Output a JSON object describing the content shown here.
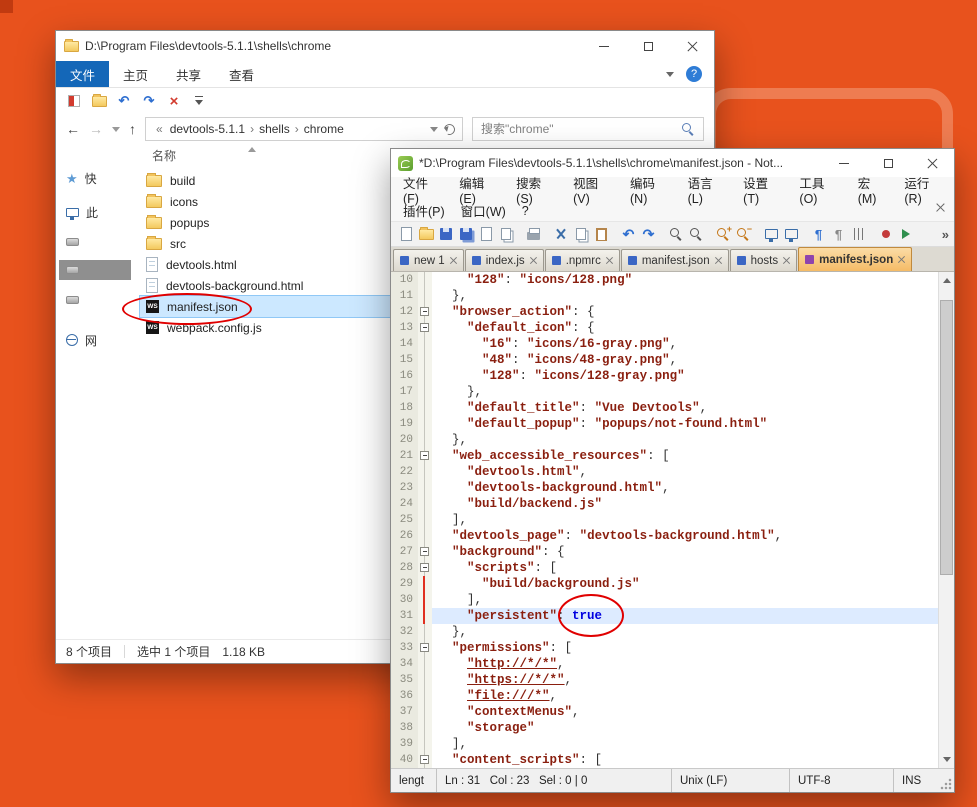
{
  "icons": {
    "ws_badge": "WS",
    "breadcrumb_prefix": "«",
    "breadcrumb_separator": "›",
    "back_arrow": "←",
    "forward_arrow": "→",
    "up_arrow": "↑",
    "undo_glyph": "↶",
    "redo_glyph": "↷",
    "delete_glyph": "×",
    "overflow_glyph": "»",
    "star_glyph": "★",
    "help_glyph": "?",
    "paragraph_glyph": "¶"
  },
  "explorer": {
    "window_title": "D:\\Program Files\\devtools-5.1.1\\shells\\chrome",
    "ribbon_tabs": [
      {
        "label": "文件",
        "active": true
      },
      {
        "label": "主页",
        "active": false
      },
      {
        "label": "共享",
        "active": false
      },
      {
        "label": "查看",
        "active": false
      }
    ],
    "qat_icons": [
      {
        "name": "properties-icon"
      },
      {
        "name": "new-folder-icon"
      },
      {
        "name": "undo-icon"
      },
      {
        "name": "redo-icon"
      },
      {
        "name": "delete-icon"
      },
      {
        "name": "customize-toolbar-icon"
      }
    ],
    "breadcrumb": {
      "prefix": "«",
      "segments": [
        "devtools-5.1.1",
        "shells",
        "chrome"
      ]
    },
    "search": {
      "placeholder": "搜索\"chrome\""
    },
    "columns": {
      "name": "名称"
    },
    "sidebar": [
      {
        "icon": "star-icon",
        "label": "快",
        "selected": false
      },
      {
        "icon": "monitor-icon",
        "label": "此",
        "selected": false
      },
      {
        "icon": "drive-icon",
        "label": "",
        "selected": false
      },
      {
        "icon": "drive-icon",
        "label": "",
        "selected": true
      },
      {
        "icon": "drive-icon",
        "label": "",
        "selected": false
      },
      {
        "icon": "network-icon",
        "label": "网",
        "selected": false
      }
    ],
    "files": [
      {
        "name": "build",
        "type": "folder",
        "selected": false
      },
      {
        "name": "icons",
        "type": "folder",
        "selected": false
      },
      {
        "name": "popups",
        "type": "folder",
        "selected": false
      },
      {
        "name": "src",
        "type": "folder",
        "selected": false
      },
      {
        "name": "devtools.html",
        "type": "html",
        "selected": false
      },
      {
        "name": "devtools-background.html",
        "type": "html",
        "selected": false
      },
      {
        "name": "manifest.json",
        "type": "ws",
        "selected": true
      },
      {
        "name": "webpack.config.js",
        "type": "ws",
        "selected": false
      }
    ],
    "status": {
      "total": "8 个项目",
      "selected": "选中 1 个项目",
      "size": "1.18 KB"
    }
  },
  "notepad": {
    "window_title": "*D:\\Program Files\\devtools-5.1.1\\shells\\chrome\\manifest.json - Not...",
    "menu_row1": [
      "文件(F)",
      "编辑(E)",
      "搜索(S)",
      "视图(V)",
      "编码(N)",
      "语言(L)",
      "设置(T)",
      "工具(O)",
      "宏(M)",
      "运行(R)"
    ],
    "menu_row2": [
      "插件(P)",
      "窗口(W)",
      "?"
    ],
    "toolbar_icons": [
      {
        "name": "new-file-icon",
        "sep": false
      },
      {
        "name": "open-file-icon",
        "sep": false
      },
      {
        "name": "save-icon",
        "sep": false
      },
      {
        "name": "save-all-icon",
        "sep": false
      },
      {
        "name": "close-file-icon",
        "sep": false
      },
      {
        "name": "close-all-icon",
        "sep": false
      },
      {
        "name": "print-icon",
        "sep": true
      },
      {
        "name": "cut-icon",
        "sep": true
      },
      {
        "name": "copy-icon",
        "sep": false
      },
      {
        "name": "paste-icon",
        "sep": false
      },
      {
        "name": "undo-icon",
        "sep": true
      },
      {
        "name": "redo-icon",
        "sep": false
      },
      {
        "name": "find-icon",
        "sep": true
      },
      {
        "name": "replace-icon",
        "sep": false
      },
      {
        "name": "zoom-in-icon",
        "sep": true
      },
      {
        "name": "zoom-out-icon",
        "sep": false
      },
      {
        "name": "sync-scroll-v-icon",
        "sep": true
      },
      {
        "name": "sync-scroll-h-icon",
        "sep": false
      },
      {
        "name": "word-wrap-icon",
        "sep": true
      },
      {
        "name": "show-all-chars-icon",
        "sep": false
      },
      {
        "name": "indent-guide-icon",
        "sep": false
      },
      {
        "name": "record-macro-icon",
        "sep": true
      },
      {
        "name": "play-macro-icon",
        "sep": false
      }
    ],
    "tabs": [
      {
        "label": "new 1",
        "active": false
      },
      {
        "label": "index.js",
        "active": false
      },
      {
        "label": ".npmrc",
        "active": false
      },
      {
        "label": "manifest.json",
        "active": false
      },
      {
        "label": "hosts",
        "active": false
      },
      {
        "label": "manifest.json",
        "active": true
      }
    ],
    "editor": {
      "lines": [
        {
          "num": 10,
          "text": "    \"128\": \"icons/128.png\"",
          "fold": "line",
          "red": false,
          "current": false
        },
        {
          "num": 11,
          "text": "  },",
          "fold": "line",
          "red": false,
          "current": false
        },
        {
          "num": 12,
          "text": "  \"browser_action\": {",
          "fold": "box",
          "red": false,
          "current": false
        },
        {
          "num": 13,
          "text": "    \"default_icon\": {",
          "fold": "box",
          "red": false,
          "current": false
        },
        {
          "num": 14,
          "text": "      \"16\": \"icons/16-gray.png\",",
          "fold": "line",
          "red": false,
          "current": false
        },
        {
          "num": 15,
          "text": "      \"48\": \"icons/48-gray.png\",",
          "fold": "line",
          "red": false,
          "current": false
        },
        {
          "num": 16,
          "text": "      \"128\": \"icons/128-gray.png\"",
          "fold": "line",
          "red": false,
          "current": false
        },
        {
          "num": 17,
          "text": "    },",
          "fold": "line",
          "red": false,
          "current": false
        },
        {
          "num": 18,
          "text": "    \"default_title\": \"Vue Devtools\",",
          "fold": "line",
          "red": false,
          "current": false
        },
        {
          "num": 19,
          "text": "    \"default_popup\": \"popups/not-found.html\"",
          "fold": "line",
          "red": false,
          "current": false
        },
        {
          "num": 20,
          "text": "  },",
          "fold": "line",
          "red": false,
          "current": false
        },
        {
          "num": 21,
          "text": "  \"web_accessible_resources\": [",
          "fold": "box",
          "red": false,
          "current": false
        },
        {
          "num": 22,
          "text": "    \"devtools.html\",",
          "fold": "line",
          "red": false,
          "current": false
        },
        {
          "num": 23,
          "text": "    \"devtools-background.html\",",
          "fold": "line",
          "red": false,
          "current": false
        },
        {
          "num": 24,
          "text": "    \"build/backend.js\"",
          "fold": "line",
          "red": false,
          "current": false
        },
        {
          "num": 25,
          "text": "  ],",
          "fold": "line",
          "red": false,
          "current": false
        },
        {
          "num": 26,
          "text": "  \"devtools_page\": \"devtools-background.html\",",
          "fold": "line",
          "red": false,
          "current": false
        },
        {
          "num": 27,
          "text": "  \"background\": {",
          "fold": "box",
          "red": false,
          "current": false
        },
        {
          "num": 28,
          "text": "    \"scripts\": [",
          "fold": "box",
          "red": false,
          "current": false
        },
        {
          "num": 29,
          "text": "      \"build/background.js\"",
          "fold": "line",
          "red": true,
          "current": false
        },
        {
          "num": 30,
          "text": "    ],",
          "fold": "line",
          "red": true,
          "current": false
        },
        {
          "num": 31,
          "text": "    \"persistent\": true",
          "fold": "line",
          "red": true,
          "current": true
        },
        {
          "num": 32,
          "text": "  },",
          "fold": "line",
          "red": false,
          "current": false
        },
        {
          "num": 33,
          "text": "  \"permissions\": [",
          "fold": "box",
          "red": false,
          "current": false
        },
        {
          "num": 34,
          "text": "    \"http://*/*\",",
          "fold": "line",
          "red": false,
          "current": false
        },
        {
          "num": 35,
          "text": "    \"https://*/*\",",
          "fold": "line",
          "red": false,
          "current": false
        },
        {
          "num": 36,
          "text": "    \"file:///*\",",
          "fold": "line",
          "red": false,
          "current": false
        },
        {
          "num": 37,
          "text": "    \"contextMenus\",",
          "fold": "line",
          "red": false,
          "current": false
        },
        {
          "num": 38,
          "text": "    \"storage\"",
          "fold": "line",
          "red": false,
          "current": false
        },
        {
          "num": 39,
          "text": "  ],",
          "fold": "line",
          "red": false,
          "current": false
        },
        {
          "num": 40,
          "text": "  \"content_scripts\": [",
          "fold": "box",
          "red": false,
          "current": false
        }
      ]
    },
    "status_bar": {
      "left": "lengt",
      "pos": "Ln : 31   Col : 23   Sel : 0 | 0",
      "eol": "Unix (LF)",
      "encoding": "UTF-8",
      "mode": "INS"
    }
  }
}
